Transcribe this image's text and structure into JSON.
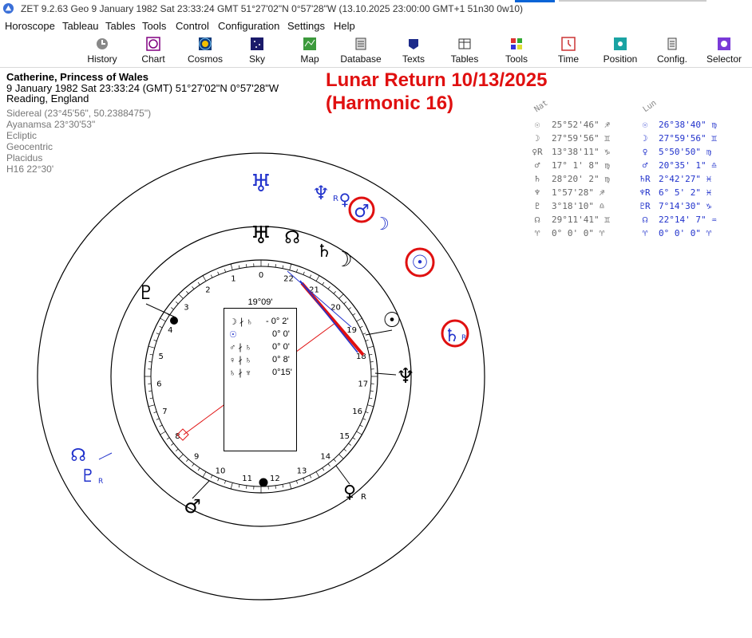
{
  "window": {
    "title": "ZET 9.2.63 Geo    9 January 1982  Sat  23:33:24 GMT 51°27'02\"N  0°57'28\"W  (13.10.2025  23:00:00 GMT+1 51n30 0w10)"
  },
  "menu": {
    "items": [
      "Horoscope",
      "Tableau",
      "Tables",
      "Tools",
      "Control",
      "Configuration",
      "Settings",
      "Help"
    ]
  },
  "toolbar": {
    "buttons": [
      {
        "label": "History",
        "icon": "history-icon"
      },
      {
        "label": "Chart",
        "icon": "chart-icon"
      },
      {
        "label": "Cosmos",
        "icon": "cosmos-icon"
      },
      {
        "label": "Sky",
        "icon": "sky-icon"
      },
      {
        "label": "Map",
        "icon": "map-icon"
      },
      {
        "label": "Database",
        "icon": "database-icon"
      },
      {
        "label": "Texts",
        "icon": "texts-icon"
      },
      {
        "label": "Tables",
        "icon": "tables-icon"
      },
      {
        "label": "Tools",
        "icon": "tools-icon"
      },
      {
        "label": "Time",
        "icon": "time-icon"
      },
      {
        "label": "Position",
        "icon": "position-icon"
      },
      {
        "label": "Config.",
        "icon": "config-icon"
      },
      {
        "label": "Selector",
        "icon": "selector-icon"
      }
    ]
  },
  "chart_info": {
    "name": "Catherine, Princess of Wales",
    "datetime": "9 January 1982  Sat  23:33:24 (GMT) 51°27'02\"N  0°57'28\"W",
    "place": "Reading, England",
    "sidereal": "Sidereal (23°45'56\", 50.2388475\")",
    "ayanamsa": "Ayanamsa 23°30'53\"",
    "system1": "Ecliptic",
    "system2": "Geocentric",
    "system3": "Placidus",
    "harmonic": "H16  22°30'"
  },
  "headline": {
    "line1": "Lunar Return 10/13/2025",
    "line2": "(Harmonic 16)"
  },
  "aspect_box": {
    "degree": "19°09'",
    "rows": [
      {
        "glyph": "☽ ∤ ♄",
        "value": "- 0° 2'"
      },
      {
        "glyph": "☉",
        "value": "0° 0'"
      },
      {
        "glyph": "♂ ∤ ♄",
        "value": "0° 0'"
      },
      {
        "glyph": "♀ ∤ ♄",
        "value": "0° 8'"
      },
      {
        "glyph": "♄ ∤ ♆",
        "value": "0°15'"
      }
    ]
  },
  "wheel": {
    "inner_numbers": [
      "1",
      "2",
      "3",
      "4",
      "5",
      "6",
      "7",
      "8",
      "9",
      "10",
      "11",
      "12",
      "13",
      "14",
      "15",
      "16",
      "17",
      "18",
      "19",
      "20",
      "21",
      "22",
      "0"
    ],
    "natal_glyphs": [
      "♅",
      "☊",
      "♄",
      "☽",
      "♇",
      "☉",
      "♆",
      "♀",
      "♂"
    ],
    "transit_glyphs": [
      "♆",
      "♀",
      "♂",
      "☽",
      "☉",
      "♄",
      "☊",
      "♇"
    ],
    "transit_retro": "R",
    "natal_retro": "R"
  },
  "positions": {
    "header_natal": "Nat",
    "header_lunar": "Lun",
    "rows": [
      {
        "nsym": "☉",
        "nval": "25°52'46\" ♐",
        "lsym": "☉",
        "lval": "26°38'40\" ♍"
      },
      {
        "nsym": "☽",
        "nval": "27°59'56\" ♊",
        "lsym": "☽",
        "lval": "27°59'56\" ♊"
      },
      {
        "nsym": "♀R",
        "nval": "13°38'11\" ♑",
        "lsym": "♀",
        "lval": " 5°50'50\" ♍"
      },
      {
        "nsym": "♂",
        "nval": "17° 1' 8\" ♍",
        "lsym": "♂",
        "lval": "20°35' 1\" ♎"
      },
      {
        "nsym": "♄",
        "nval": "28°20' 2\" ♍",
        "lsym": "♄R",
        "lval": " 2°42'27\" ♓"
      },
      {
        "nsym": "♆",
        "nval": " 1°57'28\" ♐",
        "lsym": "♆R",
        "lval": " 6° 5' 2\" ♓"
      },
      {
        "nsym": "♇",
        "nval": " 3°18'10\" ♎",
        "lsym": "♇R",
        "lval": " 7°14'30\" ♑"
      },
      {
        "nsym": "☊",
        "nval": "29°11'41\" ♊",
        "lsym": "☊",
        "lval": "22°14' 7\" ♒"
      },
      {
        "nsym": "♈",
        "nval": " 0° 0' 0\" ♈",
        "lsym": "♈",
        "lval": " 0° 0' 0\" ♈"
      }
    ]
  },
  "colors": {
    "transit": "#2233cc",
    "highlight": "#e01010",
    "natal": "#000000"
  }
}
